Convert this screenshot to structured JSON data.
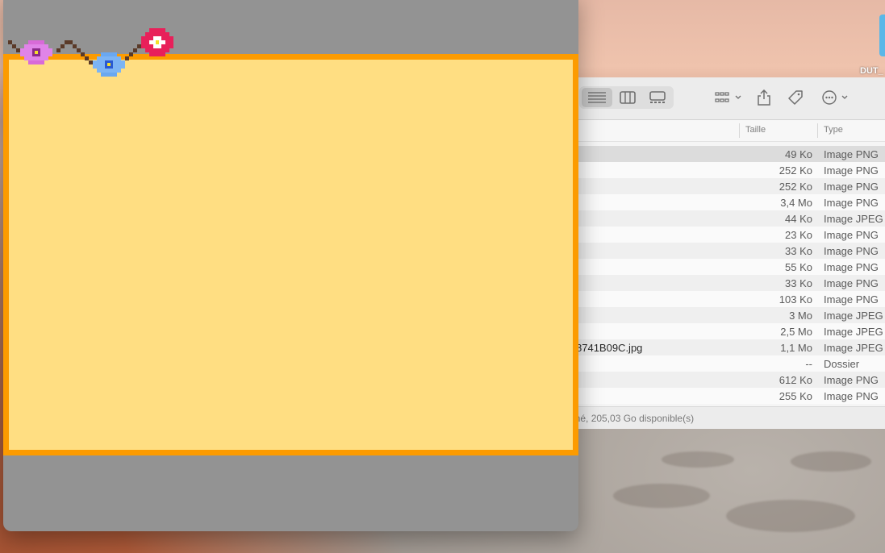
{
  "desktop": {
    "folder_label": "DUT_"
  },
  "finder": {
    "toolbar_icons": [
      "list-view-icon",
      "column-view-icon",
      "gallery-view-icon",
      "group-icon",
      "share-icon",
      "tag-icon",
      "more-icon"
    ],
    "columns": {
      "size": "Taille",
      "type": "Type"
    },
    "rows": [
      {
        "name": "",
        "size": "49 Ko",
        "type": "Image PNG",
        "selected": true
      },
      {
        "name": "",
        "size": "252 Ko",
        "type": "Image PNG"
      },
      {
        "name": "",
        "size": "252 Ko",
        "type": "Image PNG"
      },
      {
        "name": "",
        "size": "3,4 Mo",
        "type": "Image PNG"
      },
      {
        "name": "",
        "size": "44 Ko",
        "type": "Image JPEG"
      },
      {
        "name": "",
        "size": "23 Ko",
        "type": "Image PNG"
      },
      {
        "name": "",
        "size": "33 Ko",
        "type": "Image PNG"
      },
      {
        "name": "",
        "size": "55 Ko",
        "type": "Image PNG"
      },
      {
        "name": "",
        "size": "33 Ko",
        "type": "Image PNG"
      },
      {
        "name": "",
        "size": "103 Ko",
        "type": "Image PNG"
      },
      {
        "name": "",
        "size": "3 Mo",
        "type": "Image JPEG"
      },
      {
        "name": "",
        "size": "2,5 Mo",
        "type": "Image JPEG"
      },
      {
        "name": "8741B09C.jpg",
        "size": "1,1 Mo",
        "type": "Image JPEG"
      },
      {
        "name": "",
        "size": "--",
        "type": "Dossier"
      },
      {
        "name": "",
        "size": "612 Ko",
        "type": "Image PNG"
      },
      {
        "name": "",
        "size": "255 Ko",
        "type": "Image PNG"
      }
    ],
    "status": "nné, 205,03 Go disponible(s)"
  },
  "app": {
    "card_color": "#ffde82",
    "border_color": "#fc9b00",
    "decorations": [
      "pink-flower-icon",
      "blue-flower-icon",
      "red-flower-icon"
    ]
  }
}
